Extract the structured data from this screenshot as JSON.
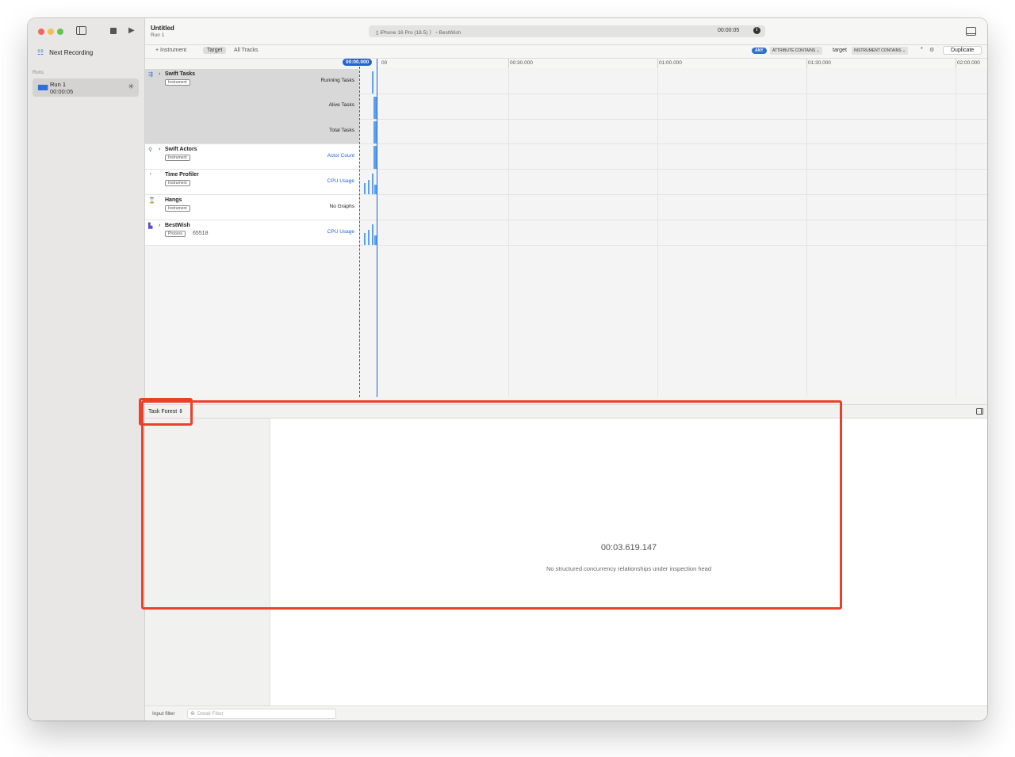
{
  "sidebar": {
    "next_recording": "Next Recording",
    "runs_label": "Runs",
    "run": {
      "name": "Run 1",
      "time": "00:00:05"
    }
  },
  "toolbar": {
    "title": "Untitled",
    "subtitle": "Run 1",
    "device": "iPhone 16 Pro (18.5)",
    "app": "BestWish",
    "elapsed": "00:00:05"
  },
  "filterbar": {
    "add_instrument": "+ Instrument",
    "target": "Target",
    "all_tracks": "All Tracks",
    "any_badge": "ANY",
    "attribute_filter": "ATTRIBUTE CONTAINS",
    "target_value": "target",
    "instrument_filter": "INSTRUMENT CONTAINS",
    "duplicate": "Duplicate"
  },
  "ruler": {
    "playhead": "00:00.000",
    "ticks": [
      "00:30.000",
      "01:00.000",
      "01:30.000",
      "02:00.000"
    ]
  },
  "tracks": [
    {
      "name": "Swift Tasks",
      "badge": "Instrument",
      "graphs": [
        "Running Tasks",
        "Alive Tasks",
        "Total Tasks"
      ]
    },
    {
      "name": "Swift Actors",
      "badge": "Instrument",
      "graphs": [
        "Actor Count"
      ]
    },
    {
      "name": "Time Profiler",
      "badge": "Instrument",
      "graphs": [
        "CPU Usage"
      ]
    },
    {
      "name": "Hangs",
      "badge": "Instrument",
      "graphs": [
        "No Graphs"
      ]
    },
    {
      "name": "BestWish",
      "badge": "Process",
      "pid": "65518",
      "graphs": [
        "CPU Usage"
      ]
    }
  ],
  "detail": {
    "view_selector": "Task Forest",
    "timestamp": "00:03.619.147",
    "message": "No structured concurrency relationships under inspection head"
  },
  "bottom": {
    "input_filter": "Input filter",
    "detail_filter_placeholder": "Detail Filter"
  },
  "colors": {
    "accent": "#2063d1",
    "graph": "#5aa0ef",
    "highlight": "#e8432a"
  }
}
